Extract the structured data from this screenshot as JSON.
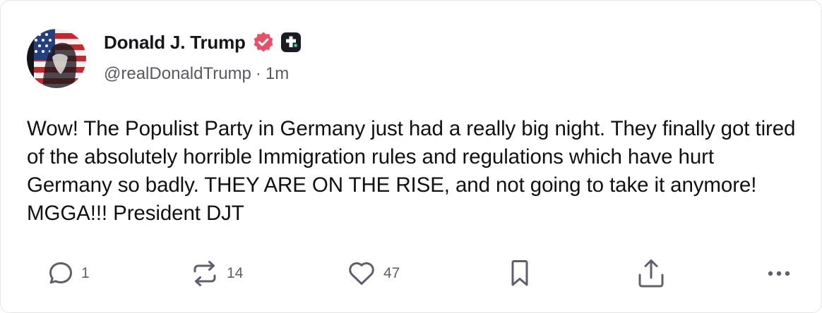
{
  "post": {
    "author": {
      "display_name": "Donald J. Trump",
      "handle": "@realDonaldTrump",
      "time": "1m",
      "separator": "·",
      "avatar_icon": "flag-portrait-avatar",
      "verified_icon": "verified-check-icon",
      "badge_icon": "plus-badge-icon"
    },
    "text": "Wow! The Populist Party in Germany just had a really big night. They finally got tired of the absolutely horrible Immigration rules and regulations which have hurt Germany so badly. THEY ARE ON THE RISE, and not going to take it anymore! MGGA!!! President DJT",
    "actions": {
      "reply_count": "1",
      "repost_count": "14",
      "like_count": "47"
    },
    "colors": {
      "verified": "#e8506a",
      "badge": "#1b1b22",
      "text": "#111111",
      "muted": "#595964"
    }
  }
}
